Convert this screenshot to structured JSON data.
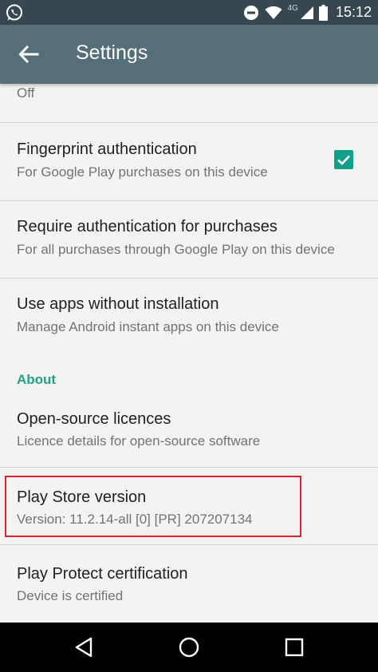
{
  "status_bar": {
    "network_label": "4G",
    "time": "15:12"
  },
  "toolbar": {
    "title": "Settings"
  },
  "settings": {
    "partial_item": {
      "secondary": "Off"
    },
    "fingerprint": {
      "primary": "Fingerprint authentication",
      "secondary": "For Google Play purchases on this device",
      "checked": true
    },
    "require_auth": {
      "primary": "Require authentication for purchases",
      "secondary": "For all purchases through Google Play on this device"
    },
    "instant_apps": {
      "primary": "Use apps without installation",
      "secondary": "Manage Android instant apps on this device"
    },
    "about_header": "About",
    "licences": {
      "primary": "Open-source licences",
      "secondary": "Licence details for open-source software"
    },
    "version": {
      "primary": "Play Store version",
      "secondary": "Version: 11.2.14-all [0] [PR] 207207134"
    },
    "protect": {
      "primary": "Play Protect certification",
      "secondary": "Device is certified"
    }
  },
  "colors": {
    "status_bar": "#37474f",
    "toolbar": "#546e7a",
    "accent": "#26a085",
    "highlight_box": "#e0202e"
  }
}
